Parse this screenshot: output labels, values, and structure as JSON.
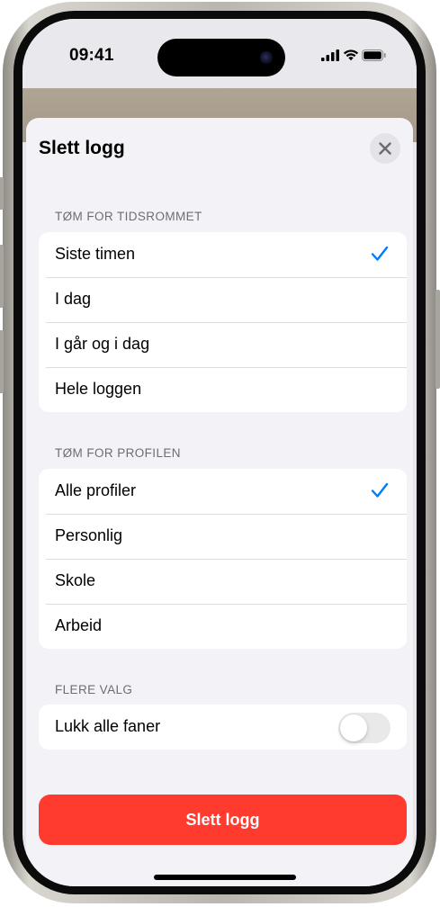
{
  "status_bar": {
    "time": "09:41",
    "icons": [
      "cellular-signal-icon",
      "wifi-icon",
      "battery-icon"
    ]
  },
  "sheet": {
    "title": "Slett logg",
    "close_icon": "close-icon"
  },
  "time_range": {
    "header": "TØM FOR TIDSROMMET",
    "options": [
      {
        "label": "Siste timen",
        "selected": true
      },
      {
        "label": "I dag",
        "selected": false
      },
      {
        "label": "I går og i dag",
        "selected": false
      },
      {
        "label": "Hele loggen",
        "selected": false
      }
    ]
  },
  "profile": {
    "header": "TØM FOR PROFILEN",
    "options": [
      {
        "label": "Alle profiler",
        "selected": true
      },
      {
        "label": "Personlig",
        "selected": false
      },
      {
        "label": "Skole",
        "selected": false
      },
      {
        "label": "Arbeid",
        "selected": false
      }
    ]
  },
  "more_options": {
    "header": "FLERE VALG",
    "close_all_tabs": {
      "label": "Lukk alle faner",
      "enabled": false
    }
  },
  "action": {
    "delete_label": "Slett logg"
  },
  "colors": {
    "accent": "#007aff",
    "destructive": "#ff3b30",
    "sheet_background": "#f2f2f7"
  }
}
